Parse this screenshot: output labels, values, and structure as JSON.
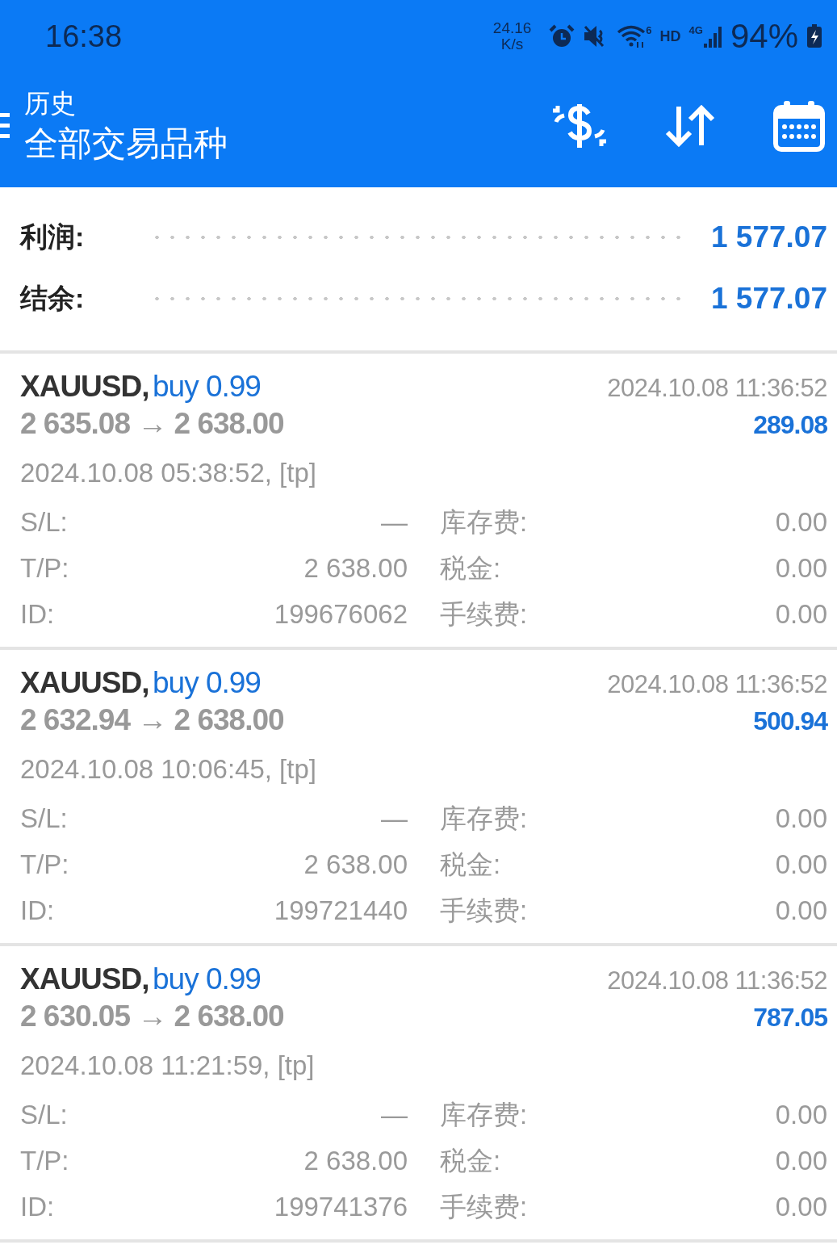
{
  "status_bar": {
    "time": "16:38",
    "net_speed": "24.16",
    "net_unit": "K/s",
    "wifi_badge": "6",
    "hd": "HD",
    "network": "4G",
    "battery": "94%"
  },
  "header": {
    "title": "历史",
    "subtitle": "全部交易品种"
  },
  "summary": [
    {
      "label": "利润:",
      "value": "1 577.07"
    },
    {
      "label": "结余:",
      "value": "1 577.07"
    }
  ],
  "trades": [
    {
      "symbol": "XAUUSD,",
      "side": "buy 0.99",
      "close_time": "2024.10.08 11:36:52",
      "prices": "2 635.08 → 2 638.00",
      "profit": "289.08",
      "open_time": "2024.10.08 05:38:52, [tp]",
      "fields": [
        {
          "label": "S/L:",
          "value": "—",
          "label2": "库存费:",
          "value2": "0.00"
        },
        {
          "label": "T/P:",
          "value": "2 638.00",
          "label2": "税金:",
          "value2": "0.00"
        },
        {
          "label": "ID:",
          "value": "199676062",
          "label2": "手续费:",
          "value2": "0.00"
        }
      ]
    },
    {
      "symbol": "XAUUSD,",
      "side": "buy 0.99",
      "close_time": "2024.10.08 11:36:52",
      "prices": "2 632.94 → 2 638.00",
      "profit": "500.94",
      "open_time": "2024.10.08 10:06:45, [tp]",
      "fields": [
        {
          "label": "S/L:",
          "value": "—",
          "label2": "库存费:",
          "value2": "0.00"
        },
        {
          "label": "T/P:",
          "value": "2 638.00",
          "label2": "税金:",
          "value2": "0.00"
        },
        {
          "label": "ID:",
          "value": "199721440",
          "label2": "手续费:",
          "value2": "0.00"
        }
      ]
    },
    {
      "symbol": "XAUUSD,",
      "side": "buy 0.99",
      "close_time": "2024.10.08 11:36:52",
      "prices": "2 630.05 → 2 638.00",
      "profit": "787.05",
      "open_time": "2024.10.08 11:21:59, [tp]",
      "fields": [
        {
          "label": "S/L:",
          "value": "—",
          "label2": "库存费:",
          "value2": "0.00"
        },
        {
          "label": "T/P:",
          "value": "2 638.00",
          "label2": "税金:",
          "value2": "0.00"
        },
        {
          "label": "ID:",
          "value": "199741376",
          "label2": "手续费:",
          "value2": "0.00"
        }
      ]
    }
  ]
}
